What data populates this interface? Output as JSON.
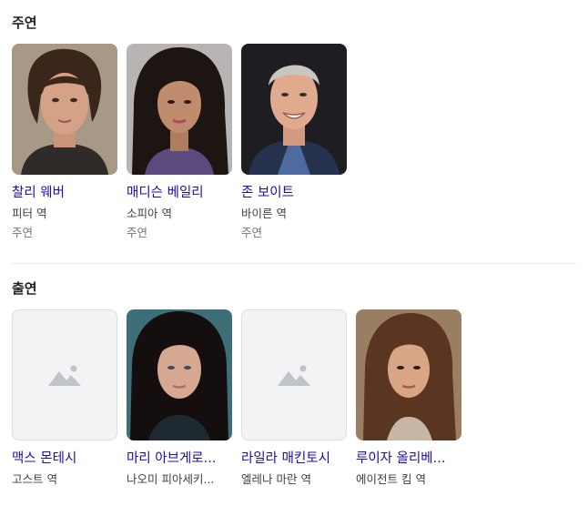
{
  "main_cast": {
    "title": "주연",
    "cards": [
      {
        "name": "찰리 웨버",
        "role": "피터 역",
        "credit": "주연"
      },
      {
        "name": "매디슨 베일리",
        "role": "소피아 역",
        "credit": "주연"
      },
      {
        "name": "존 보이트",
        "role": "바이른 역",
        "credit": "주연"
      }
    ]
  },
  "supporting_cast": {
    "title": "출연",
    "cards": [
      {
        "name": "맥스 몬테시",
        "role": "고스트 역"
      },
      {
        "name": "마리 아브게로...",
        "role": "나오미 피아세키..."
      },
      {
        "name": "라일라 매킨토시",
        "role": "엘레나 마란 역"
      },
      {
        "name": "루이자 올리베...",
        "role": "에이전트 킴 역"
      }
    ]
  }
}
